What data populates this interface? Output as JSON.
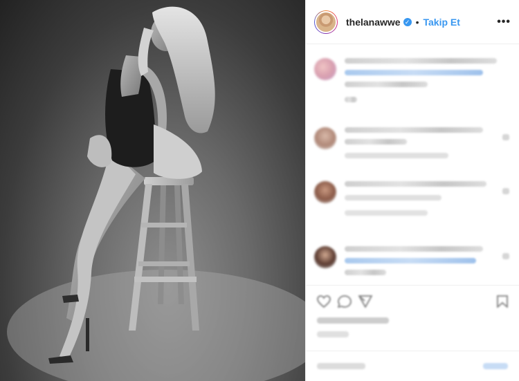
{
  "post": {
    "username": "thelanawwe",
    "separator": "•",
    "follow_label": "Takip Et",
    "more_symbol": "•••",
    "verified_symbol": "✓"
  },
  "colors": {
    "link_blue": "#3897f0",
    "text_dark": "#262626",
    "border": "#efefef"
  },
  "icons": [
    "heart-icon",
    "comment-icon",
    "share-icon",
    "bookmark-icon",
    "verified-badge-icon",
    "more-options-icon"
  ]
}
